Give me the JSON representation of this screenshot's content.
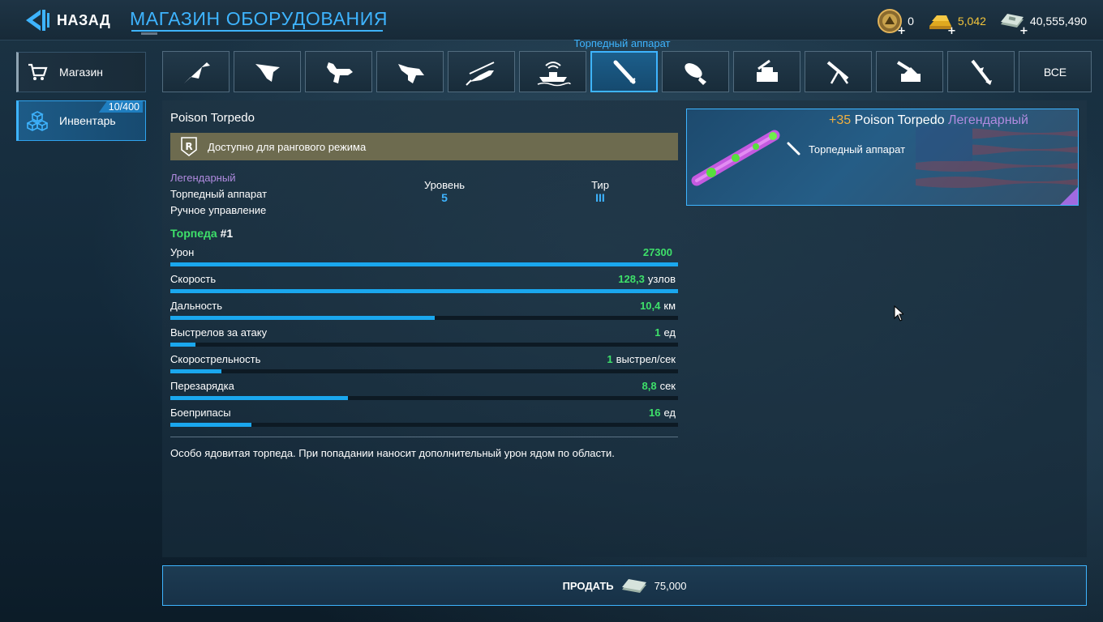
{
  "header": {
    "back_label": "НАЗАД",
    "title": "МАГАЗИН ОБОРУДОВАНИЯ"
  },
  "currencies": [
    {
      "icon": "medal-coin-icon",
      "value": "0",
      "color": "#ffffff"
    },
    {
      "icon": "gold-bars-icon",
      "value": "5,042",
      "color": "#f3c53b"
    },
    {
      "icon": "cash-stack-icon",
      "value": "40,555,490",
      "color": "#ffffff"
    }
  ],
  "sidebar": {
    "items": [
      {
        "label": "Магазин",
        "icon": "shopping-cart-icon",
        "active": false
      },
      {
        "label": "Инвентарь",
        "icon": "boxes-icon",
        "active": true,
        "count": "10/400"
      }
    ]
  },
  "tabs": {
    "tooltip": "Торпедный аппарат",
    "items": [
      {
        "icon": "stealth-bomber-icon"
      },
      {
        "icon": "flying-wing-icon"
      },
      {
        "icon": "jet-fighter-icon"
      },
      {
        "icon": "stealth-fighter-icon"
      },
      {
        "icon": "helicopter-icon"
      },
      {
        "icon": "boat-icon"
      },
      {
        "icon": "torpedo-icon",
        "active": true
      },
      {
        "icon": "bomb-icon"
      },
      {
        "icon": "turret-icon"
      },
      {
        "icon": "machine-gun-icon"
      },
      {
        "icon": "cannon-icon"
      },
      {
        "icon": "missile-icon"
      }
    ],
    "all_label": "ВСЕ"
  },
  "item": {
    "name": "Poison Torpedo",
    "ranked_notice": "Доступно для рангового режима",
    "rarity": "Легендарный",
    "type": "Торпедный аппарат",
    "control": "Ручное управление",
    "level_label": "Уровень",
    "level_value": "5",
    "tier_label": "Тир",
    "tier_value": "III",
    "weapon_header": "Торпеда",
    "weapon_index": "#1",
    "stats": [
      {
        "name": "Урон",
        "value": "27300",
        "unit": "",
        "fill": 1.0
      },
      {
        "name": "Скорость",
        "value": "128,3",
        "unit": "узлов",
        "fill": 1.0
      },
      {
        "name": "Дальность",
        "value": "10,4",
        "unit": "км",
        "fill": 0.52
      },
      {
        "name": "Выстрелов за атаку",
        "value": "1",
        "unit": "ед",
        "fill": 0.05
      },
      {
        "name": "Скорострельность",
        "value": "1",
        "unit": "выстрел/сек",
        "fill": 0.1
      },
      {
        "name": "Перезарядка",
        "value": "8,8",
        "unit": "сек",
        "fill": 0.35
      },
      {
        "name": "Боеприпасы",
        "value": "16",
        "unit": "ед",
        "fill": 0.16
      }
    ],
    "description": "Особо ядовитая торпеда. При попадании наносит дополнительный урон ядом по области."
  },
  "card": {
    "upgrade": "+35",
    "name": "Poison Torpedo",
    "rarity": "Легендарный",
    "type": "Торпедный аппарат"
  },
  "sell": {
    "label": "ПРОДАТЬ",
    "price": "75,000"
  },
  "colors": {
    "accent": "#3eb4ff",
    "stat_green": "#3ee06a",
    "legendary": "#b18be0",
    "gold": "#f3c53b",
    "upgrade": "#f0b040",
    "bar_fill": "#1aa7ee"
  }
}
